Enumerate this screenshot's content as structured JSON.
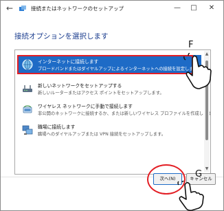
{
  "window": {
    "title": "接続またはネットワークのセットアップ",
    "back_icon": "back-arrow-icon",
    "minimize": "—",
    "maximize": "□",
    "close": "✕"
  },
  "heading": "接続オプションを選択します",
  "options": [
    {
      "icon": "globe-icon",
      "title": "インターネットに接続します",
      "desc": "ブロードバンドまたはダイヤルアップによるインターネットへの接続を設定します。",
      "selected": true
    },
    {
      "icon": "router-icon",
      "title": "新しいネットワークをセットアップする",
      "desc": "新しいルーターまたはアクセス ポイントをセットアップします。",
      "selected": false
    },
    {
      "icon": "wireless-icon",
      "title": "ワイヤレス ネットワークに手動で接続します",
      "desc": "非公開のネットワークに接続するか、または新しいワイヤレス プロファイルを作成します。",
      "selected": false
    },
    {
      "icon": "workplace-icon",
      "title": "職場に接続します",
      "desc": "職場へのダイヤルアップまたは VPN 接続をセットアップします。",
      "selected": false
    }
  ],
  "buttons": {
    "next": "次へ(N)",
    "cancel": "キャンセル"
  },
  "callouts": {
    "f": "F",
    "g": "G"
  },
  "colors": {
    "accent": "#1e6bc6",
    "highlight": "#e31e24",
    "heading": "#1a3c8e"
  }
}
